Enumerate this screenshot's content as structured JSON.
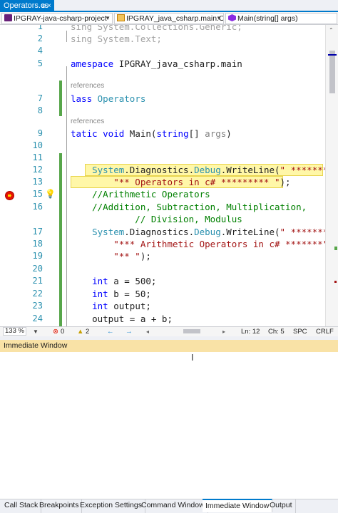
{
  "tab": {
    "title": "Operators.cs",
    "pin": "⊕",
    "close": "×"
  },
  "nav": {
    "project": "IPGRAY-java-csharp-project",
    "class_path": "IPGRAY_java_csharp.main.Ope",
    "member": "Main(string[] args)"
  },
  "code": {
    "lines": [
      {
        "n": "1",
        "segments": [
          {
            "t": "sing ",
            "c": "gr"
          },
          {
            "t": "System.Collections.Generic;",
            "c": "gr"
          }
        ]
      },
      {
        "n": "2",
        "segments": [
          {
            "t": "sing ",
            "c": "gr"
          },
          {
            "t": "System.Text;",
            "c": "gr"
          }
        ]
      },
      {
        "n": "4",
        "segments": []
      },
      {
        "n": "5",
        "segments": [
          {
            "t": "amespace ",
            "c": "kw"
          },
          {
            "t": "IPGRAY_java_csharp.main",
            "c": ""
          }
        ]
      },
      {
        "n": "7",
        "segments": [
          {
            "t": "lass ",
            "c": "kw"
          },
          {
            "t": "Operators",
            "c": "ty"
          }
        ]
      },
      {
        "n": "8",
        "segments": []
      },
      {
        "n": "9",
        "segments": [
          {
            "t": "tatic void ",
            "c": "kw"
          },
          {
            "t": "Main(",
            "c": ""
          },
          {
            "t": "string",
            "c": "kw"
          },
          {
            "t": "[] ",
            "c": ""
          },
          {
            "t": "args",
            "c": "pm"
          },
          {
            "t": ")",
            "c": ""
          }
        ]
      },
      {
        "n": "10",
        "segments": []
      },
      {
        "n": "11",
        "segments": []
      },
      {
        "n": "12",
        "segments": [
          {
            "t": "    System",
            "c": "ty"
          },
          {
            "t": ".Diagnostics.",
            "c": ""
          },
          {
            "t": "Debug",
            "c": "ty"
          },
          {
            "t": ".WriteLine(",
            "c": ""
          },
          {
            "t": "\" *********",
            "c": "str"
          }
        ]
      },
      {
        "n": "13",
        "segments": [
          {
            "t": "        \"** Operators in c# ********* \"",
            "c": "str"
          },
          {
            "t": ");",
            "c": ""
          }
        ]
      },
      {
        "n": "15",
        "segments": [
          {
            "t": "    //Arithmetic Operators",
            "c": "cm"
          }
        ]
      },
      {
        "n": "16",
        "segments": [
          {
            "t": "    //Addition, Subtraction, Multiplication,",
            "c": "cm"
          }
        ]
      },
      {
        "n": "",
        "segments": [
          {
            "t": "            // Division, Modulus",
            "c": "cm"
          }
        ]
      },
      {
        "n": "17",
        "segments": [
          {
            "t": "    System",
            "c": "ty"
          },
          {
            "t": ".Diagnostics.",
            "c": ""
          },
          {
            "t": "Debug",
            "c": "ty"
          },
          {
            "t": ".WriteLine(",
            "c": ""
          },
          {
            "t": "\" *******\"",
            "c": "str"
          }
        ]
      },
      {
        "n": "18",
        "segments": [
          {
            "t": "        \"*** Arithmetic Operators in c# *******\"",
            "c": "str"
          }
        ]
      },
      {
        "n": "19",
        "segments": [
          {
            "t": "        \"** \"",
            "c": "str"
          },
          {
            "t": ");",
            "c": ""
          }
        ]
      },
      {
        "n": "20",
        "segments": []
      },
      {
        "n": "21",
        "segments": [
          {
            "t": "    int ",
            "c": "kw"
          },
          {
            "t": "a = 500;",
            "c": ""
          }
        ]
      },
      {
        "n": "22",
        "segments": [
          {
            "t": "    int ",
            "c": "kw"
          },
          {
            "t": "b = 50;",
            "c": ""
          }
        ]
      },
      {
        "n": "23",
        "segments": [
          {
            "t": "    int ",
            "c": "kw"
          },
          {
            "t": "output;",
            "c": ""
          }
        ]
      },
      {
        "n": "24",
        "segments": [
          {
            "t": "    output = a + b;",
            "c": ""
          }
        ]
      }
    ],
    "lens_7": "references",
    "lens_9": "references"
  },
  "status": {
    "zoom": "133 %",
    "errors": "0",
    "warnings": "2",
    "ln": "Ln: 12",
    "ch": "Ch: 5",
    "spc": "SPC",
    "crlf": "CRLF"
  },
  "immediate": {
    "title": "Immediate Window"
  },
  "bottom_tabs": [
    {
      "label": "Call Stack"
    },
    {
      "label": "Breakpoints"
    },
    {
      "label": "Exception Settings"
    },
    {
      "label": "Command Window"
    },
    {
      "label": "Immediate Window"
    },
    {
      "label": "Output"
    }
  ],
  "colors": {
    "accent": "#007acc",
    "breakpoint": "#e51400",
    "current_line": "#fff7a8"
  }
}
